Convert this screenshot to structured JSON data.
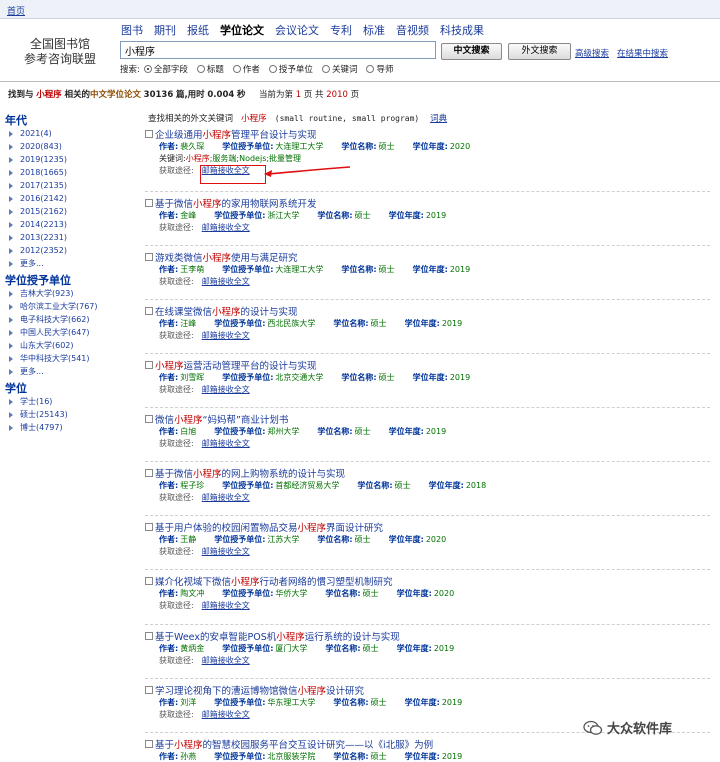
{
  "topbar": {
    "home": "首页"
  },
  "logo": {
    "line1": "全国图书馆",
    "line2": "参考咨询联盟"
  },
  "nav": {
    "tabs": [
      "图书",
      "期刊",
      "报纸",
      "学位论文",
      "会议论文",
      "专利",
      "标准",
      "音视频",
      "科技成果"
    ],
    "active_index": 3
  },
  "search": {
    "query": "小程序",
    "cn_button": "中文搜索",
    "en_button": "外文搜索",
    "advanced": "高级搜索",
    "in_results": "在结果中搜索",
    "scope_label": "搜索:",
    "scopes": [
      "全部字段",
      "标题",
      "作者",
      "授予单位",
      "关键词",
      "导师"
    ],
    "selected_scope": "全部字段"
  },
  "summary": {
    "p1": "找到与",
    "keyword": "小程序",
    "p2": "相关的",
    "type": "中文学位论文",
    "count": "30136",
    "p3": "篇,用时",
    "time": "0.004",
    "p4": "秒",
    "p5": "当前为第",
    "page": "1",
    "p6": "页 共",
    "total_pages": "2010",
    "p7": "页"
  },
  "related": {
    "label": "查找相关的外文关键词",
    "keyword": "小程序",
    "english": "(small routine, small program)",
    "dict": "词典"
  },
  "facets": [
    {
      "title": "年代",
      "items": [
        "2021(4)",
        "2020(843)",
        "2019(1235)",
        "2018(1665)",
        "2017(2135)",
        "2016(2142)",
        "2015(2162)",
        "2014(2213)",
        "2013(2231)",
        "2012(2352)",
        "更多..."
      ]
    },
    {
      "title": "学位授予单位",
      "items": [
        "吉林大学(923)",
        "哈尔滨工业大学(767)",
        "电子科技大学(662)",
        "中国人民大学(647)",
        "山东大学(602)",
        "华中科技大学(541)",
        "更多..."
      ]
    },
    {
      "title": "学位",
      "items": [
        "学士(16)",
        "硕士(25143)",
        "博士(4797)"
      ]
    }
  ],
  "labels": {
    "author": "作者:",
    "unit": "学位授予单位:",
    "degree": "学位名称:",
    "year": "学位年度:",
    "keywords": "关键词:",
    "get": "获取途径:",
    "mail": "邮箱接收全文"
  },
  "results": [
    {
      "pre": "企业级通用",
      "hl": "小程序",
      "post": "管理平台设计与实现",
      "author": "裴久琛",
      "unit": "大连理工大学",
      "degree": "硕士",
      "year": "2020",
      "kw_hl": "小程序",
      "kw_rest": ";服务端;Nodejs;批量管理"
    },
    {
      "pre": "基于微信",
      "hl": "小程序",
      "post": "的家用物联网系统开发",
      "author": "金峰",
      "unit": "浙江大学",
      "degree": "硕士",
      "year": "2019"
    },
    {
      "pre": "游戏类微信",
      "hl": "小程序",
      "post": "使用与满足研究",
      "author": "王李萌",
      "unit": "大连理工大学",
      "degree": "硕士",
      "year": "2019"
    },
    {
      "pre": "在线课堂微信",
      "hl": "小程序",
      "post": "的设计与实现",
      "author": "汪峰",
      "unit": "西北民族大学",
      "degree": "硕士",
      "year": "2019"
    },
    {
      "pre": "",
      "hl": "小程序",
      "post": "运营活动管理平台的设计与实现",
      "author": "刘雪晖",
      "unit": "北京交通大学",
      "degree": "硕士",
      "year": "2019"
    },
    {
      "pre": "微信",
      "hl": "小程序",
      "post": "“妈妈帮”商业计划书",
      "author": "白旭",
      "unit": "郑州大学",
      "degree": "硕士",
      "year": "2019"
    },
    {
      "pre": "基于微信",
      "hl": "小程序",
      "post": "的网上购物系统的设计与实现",
      "author": "程子珍",
      "unit": "首都经济贸易大学",
      "degree": "硕士",
      "year": "2018"
    },
    {
      "pre": "基于用户体验的校园闲置物品交易",
      "hl": "小程序",
      "post": "界面设计研究",
      "author": "王静",
      "unit": "江苏大学",
      "degree": "硕士",
      "year": "2020"
    },
    {
      "pre": "媒介化视域下微信",
      "hl": "小程序",
      "post": "行动者网络的慣习塑型机制研究",
      "author": "陶文冲",
      "unit": "华侨大学",
      "degree": "硕士",
      "year": "2020"
    },
    {
      "pre": "基于Weex的安卓智能POS机",
      "hl": "小程序",
      "post": "运行系统的设计与实现",
      "author": "黄炳金",
      "unit": "厦门大学",
      "degree": "硕士",
      "year": "2019"
    },
    {
      "pre": "学习理论视角下的漕运博物馆微信",
      "hl": "小程序",
      "post": "设计研究",
      "author": "刘洋",
      "unit": "华东理工大学",
      "degree": "硕士",
      "year": "2019"
    },
    {
      "pre": "基于",
      "hl": "小程序",
      "post": "的智慧校园服务平台交互设计研究——以《i北服》为例",
      "author": "孙燕",
      "unit": "北京服装学院",
      "degree": "硕士",
      "year": "2019"
    }
  ],
  "watermark": {
    "text": "大众软件库"
  }
}
